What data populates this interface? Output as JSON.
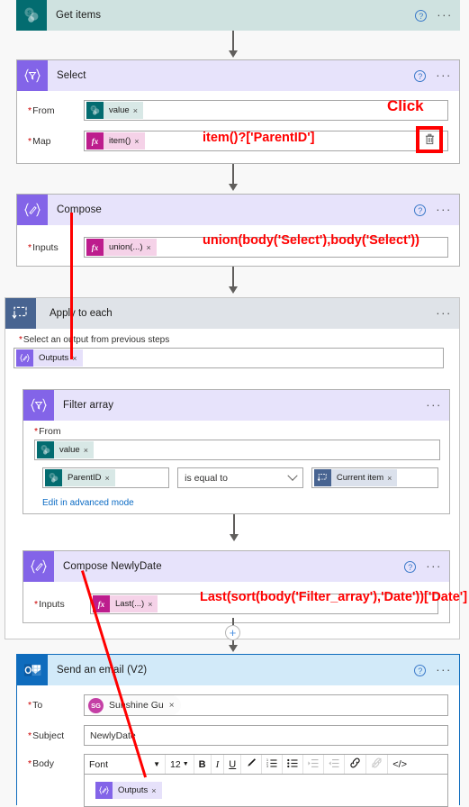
{
  "flow": {
    "steps": [
      {
        "id": "get-items",
        "title": "Get items",
        "icon": "sharepoint-icon",
        "header_color": "#cfe2e0",
        "icon_color": "#036c70",
        "help_label": "?",
        "more_label": "···"
      },
      {
        "id": "select",
        "title": "Select",
        "icon": "select-filter-icon",
        "header_color": "#e7e3fb",
        "icon_color": "#8364e8",
        "help_label": "?",
        "more_label": "···",
        "fields": [
          {
            "label": "From",
            "required": true,
            "chip": {
              "text": "value",
              "close": "×",
              "kind": "sharepoint"
            }
          },
          {
            "label": "Map",
            "required": true,
            "chip": {
              "text": "item()",
              "close": "×",
              "kind": "expression"
            },
            "annotation": "item()?['ParentID']"
          }
        ]
      },
      {
        "id": "compose",
        "title": "Compose",
        "icon": "compose-icon",
        "header_color": "#e7e3fb",
        "icon_color": "#8364e8",
        "help_label": "?",
        "more_label": "···",
        "fields": [
          {
            "label": "Inputs",
            "required": true,
            "chip": {
              "text": "union(...)",
              "close": "×",
              "kind": "expression"
            },
            "annotation": "union(body('Select'),body('Select'))"
          }
        ]
      },
      {
        "id": "apply-to-each",
        "title": "Apply to each",
        "icon": "loop-icon",
        "header_color": "#dfe3e8",
        "icon_color": "#486491",
        "more_label": "···",
        "output_label": "Select an output from previous steps",
        "output_required": true,
        "output_chip": {
          "text": "Outputs",
          "close": "×",
          "kind": "outputs"
        }
      },
      {
        "id": "filter-array",
        "title": "Filter array",
        "icon": "select-filter-icon",
        "header_color": "#e7e3fb",
        "icon_color": "#8364e8",
        "more_label": "···",
        "from_label": "From",
        "from_required": true,
        "from_chip": {
          "text": "value",
          "close": "×",
          "kind": "sharepoint"
        },
        "condition": {
          "left_chip": {
            "text": "ParentID",
            "close": "×",
            "kind": "sharepoint"
          },
          "operator": "is equal to",
          "operator_caret": "chevron-down-icon",
          "right_chip": {
            "text": "Current item",
            "close": "×",
            "kind": "current-item"
          }
        },
        "advanced_link": "Edit in advanced mode"
      },
      {
        "id": "compose-newlydate",
        "title": "Compose NewlyDate",
        "icon": "compose-icon",
        "header_color": "#e7e3fb",
        "icon_color": "#8364e8",
        "help_label": "?",
        "more_label": "···",
        "fields": [
          {
            "label": "Inputs",
            "required": true,
            "chip": {
              "text": "Last(...)",
              "close": "×",
              "kind": "expression"
            },
            "annotation": "Last(sort(body('Filter_array'),'Date'))['Date']"
          }
        ]
      },
      {
        "id": "send-an-email",
        "title": "Send an email (V2)",
        "icon": "outlook-icon",
        "header_color": "#d2eaf9",
        "icon_color": "#0f6cbd",
        "help_label": "?",
        "more_label": "···",
        "to_label": "To",
        "to_required": true,
        "to_person": {
          "initials": "SG",
          "name": "Sunshine Gu",
          "close": "×",
          "avatar_color": "#c43fa5"
        },
        "subject_label": "Subject",
        "subject_required": true,
        "subject_value": "NewlyDate",
        "body_label": "Body",
        "body_required": true,
        "toolbar": {
          "font_placeholder": "Font",
          "font_caret": "chevron-down-icon",
          "size_value": "12",
          "size_caret": "chevron-down-icon",
          "bold": "B",
          "italic": "I",
          "underline": "U",
          "highlight": "highlight-pen-icon",
          "numbered_list": "numbered-list-icon",
          "bulleted_list": "bulleted-list-icon",
          "indent": "indent-icon",
          "outdent": "outdent-icon",
          "link": "link-icon",
          "unlink": "unlink-icon",
          "code_view": "</>"
        },
        "body_chip": {
          "text": "Outputs",
          "close": "×",
          "kind": "outputs"
        }
      }
    ],
    "add_step_button": "+",
    "click_annotation": "Click",
    "delete_icon": "trash-icon",
    "annotation_color": "#ff0000"
  }
}
